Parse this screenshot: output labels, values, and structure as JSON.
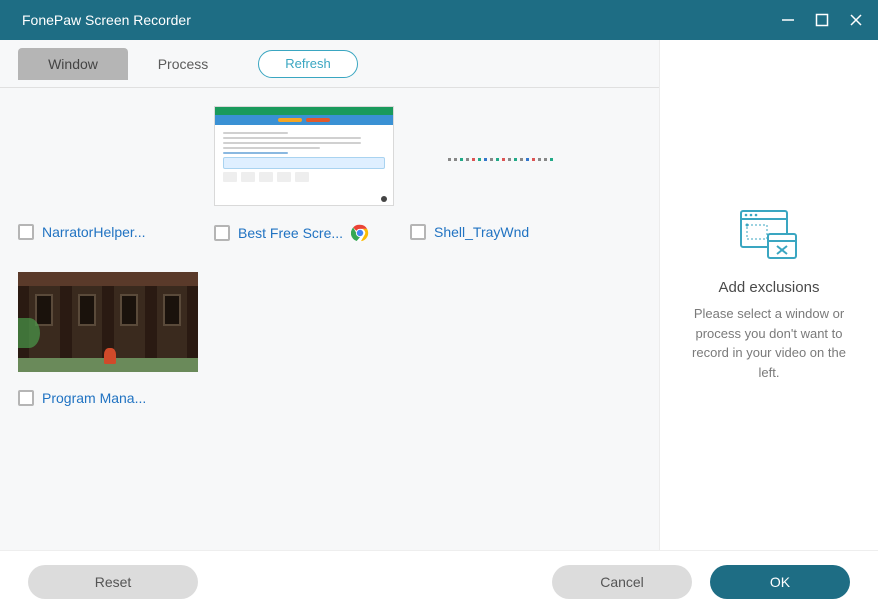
{
  "titlebar": {
    "title": "FonePaw Screen Recorder"
  },
  "tabs": {
    "window": "Window",
    "process": "Process",
    "refresh": "Refresh"
  },
  "tiles": {
    "narrator": "NarratorHelper...",
    "bestfree": "Best Free Scre...",
    "shell": "Shell_TrayWnd",
    "program": "Program Mana..."
  },
  "sidebar": {
    "title": "Add exclusions",
    "text": "Please select a window or process you don't want to record in your video on the left."
  },
  "buttons": {
    "reset": "Reset",
    "cancel": "Cancel",
    "ok": "OK"
  }
}
